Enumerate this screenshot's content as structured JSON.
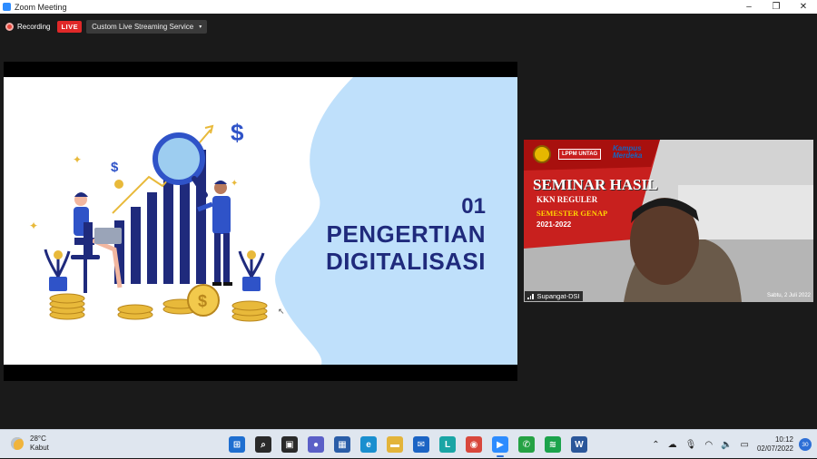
{
  "window": {
    "title": "Zoom Meeting",
    "minimize": "–",
    "maximize": "❐",
    "close": "✕"
  },
  "toolbar": {
    "recording_label": "Recording",
    "live_label": "LIVE",
    "stream_label": "Custom Live Streaming Service",
    "stream_caret": "▾"
  },
  "slide": {
    "number": "01",
    "title_line1": "PENGERTIAN",
    "title_line2": "DIGITALISASI",
    "accent": "#1f2a7c",
    "bg_blue": "#bfe0fb"
  },
  "participant": {
    "name": "Supangat-DSI",
    "banner_lppm": "LPPM UNTAG",
    "banner_kampus_1": "Kampus",
    "banner_kampus_2": "Merdeka",
    "seminar": "SEMINAR HASIL",
    "kkn": "KKN REGULER",
    "semester": "SEMESTER GENAP",
    "year": "2021-2022",
    "date": "Sabtu, 2 Juli 2022"
  },
  "taskbar": {
    "weather_temp": "28°C",
    "weather_desc": "Kabut",
    "apps": [
      {
        "name": "start-icon",
        "glyph": "⊞",
        "color": "#1f6fd0"
      },
      {
        "name": "search-icon",
        "glyph": "⌕",
        "color": "#2a2a2a"
      },
      {
        "name": "task-view-icon",
        "glyph": "▣",
        "color": "#2a2a2a"
      },
      {
        "name": "chat-icon",
        "glyph": "●",
        "color": "#5b5fc7"
      },
      {
        "name": "store-icon",
        "glyph": "▦",
        "color": "#2a5da8"
      },
      {
        "name": "edge-icon",
        "glyph": "e",
        "color": "#1a8fcf"
      },
      {
        "name": "file-explorer-icon",
        "glyph": "▬",
        "color": "#e3b43a"
      },
      {
        "name": "mail-icon",
        "glyph": "✉",
        "color": "#1c64c4"
      },
      {
        "name": "l-app-icon",
        "glyph": "L",
        "color": "#1aa5a5"
      },
      {
        "name": "chrome-icon",
        "glyph": "◉",
        "color": "#d8473c"
      },
      {
        "name": "zoom-icon",
        "glyph": "▶",
        "color": "#2d8cff"
      },
      {
        "name": "whatsapp-icon",
        "glyph": "✆",
        "color": "#25a244"
      },
      {
        "name": "spotify-icon",
        "glyph": "≋",
        "color": "#1ca34c"
      },
      {
        "name": "word-icon",
        "glyph": "W",
        "color": "#2b579a"
      }
    ],
    "tray_chevron": "⌃",
    "tray_cloud": "☁",
    "tray_mic": "🎙",
    "tray_wifi": "◠",
    "tray_volume": "🔈",
    "tray_battery": "▭",
    "time": "10:12",
    "date": "02/07/2022",
    "notifications": "30"
  },
  "colors": {
    "zoom_bg": "#1a1a1a",
    "live_red": "#e02828",
    "taskbar_bg": "#dfe6ef"
  }
}
